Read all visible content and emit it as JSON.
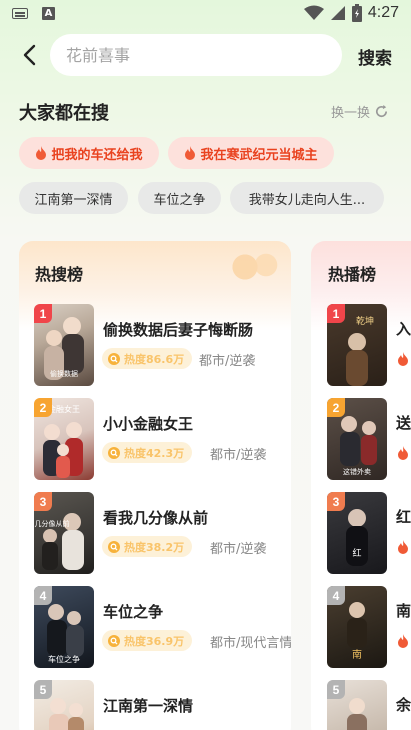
{
  "status_bar": {
    "time": "4:27"
  },
  "search": {
    "placeholder": "花前喜事",
    "button_label": "搜索"
  },
  "hot": {
    "title": "大家都在搜",
    "refresh_label": "换一换",
    "chips": [
      {
        "label": "把我的车还给我",
        "style": "hot"
      },
      {
        "label": "我在寒武纪元当城主",
        "style": "hot"
      },
      {
        "label": "江南第一深情",
        "style": "plain"
      },
      {
        "label": "车位之争",
        "style": "plain"
      },
      {
        "label": "我带女儿走向人生...",
        "style": "plain"
      }
    ]
  },
  "hot_search_list": {
    "title": "热搜榜",
    "items": [
      {
        "rank": "1",
        "title": "偷换数据后妻子悔断肠",
        "heat": "热度86.6万",
        "tags": "都市/逆袭",
        "poster_caption": "偷换数据"
      },
      {
        "rank": "2",
        "title": "小小金融女王",
        "heat": "热度42.3万",
        "tags": "都市/逆袭",
        "poster_caption": "金融女王"
      },
      {
        "rank": "3",
        "title": "看我几分像从前",
        "heat": "热度38.2万",
        "tags": "都市/逆袭",
        "poster_caption": "几分像从前"
      },
      {
        "rank": "4",
        "title": "车位之争",
        "heat": "热度36.9万",
        "tags": "都市/现代言情",
        "poster_caption": "车位之争"
      },
      {
        "rank": "5",
        "title": "江南第一深情",
        "heat": "",
        "tags": "",
        "poster_caption": ""
      }
    ]
  },
  "hot_play_list": {
    "title": "热播榜",
    "items": [
      {
        "rank": "1",
        "title": "入",
        "poster_caption": "乾坤"
      },
      {
        "rank": "2",
        "title": "送",
        "poster_caption": "这错外卖"
      },
      {
        "rank": "3",
        "title": "红",
        "poster_caption": "红"
      },
      {
        "rank": "4",
        "title": "南",
        "poster_caption": "南"
      },
      {
        "rank": "5",
        "title": "余",
        "poster_caption": ""
      }
    ]
  },
  "colors": {
    "accent": "#e9421f",
    "rank_1": "#f0454a",
    "rank_2": "#f7a431",
    "rank_3": "#f07c4f",
    "rank_other": "#b3b3b3",
    "heat_text": "#f9c46a"
  }
}
